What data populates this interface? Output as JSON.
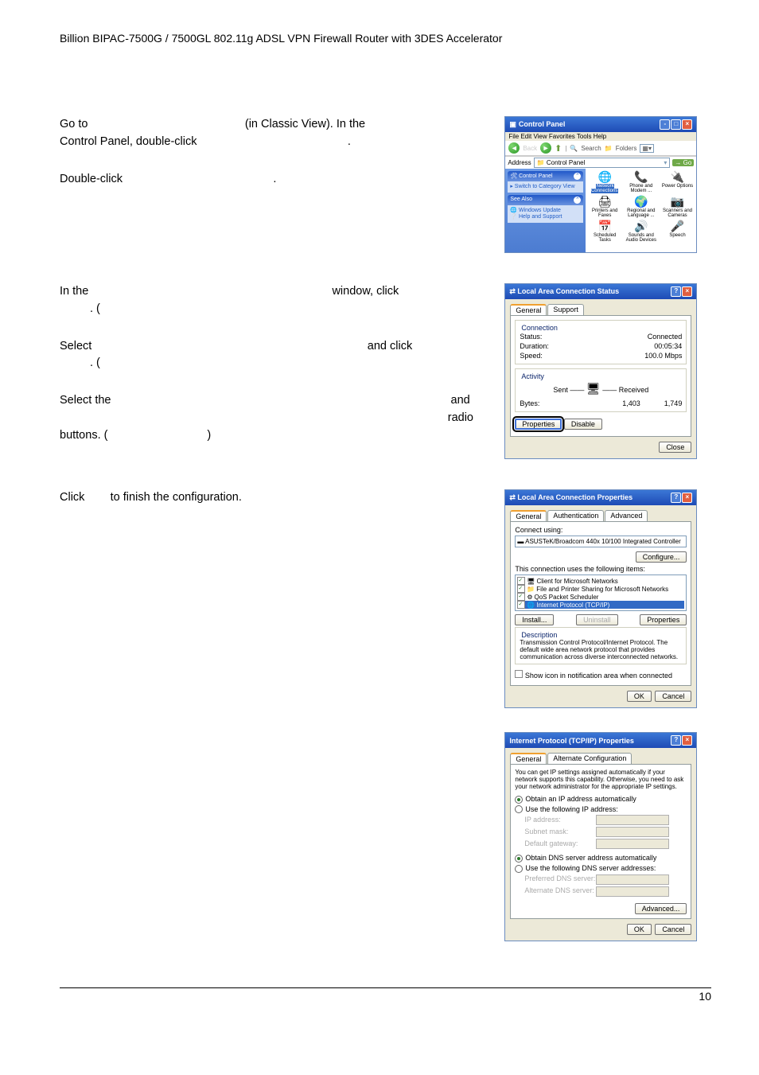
{
  "page": {
    "header": "Billion BIPAC-7500G / 7500GL 802.11g ADSL VPN Firewall Router with 3DES Accelerator",
    "footer_page": "10"
  },
  "instructions": {
    "step1a": "Go to",
    "step1b": "(in Classic View). In the",
    "step1c": "Control Panel, double-click",
    "step1d": ".",
    "step2a": "Double-click",
    "step2b": ".",
    "step3a": "In the",
    "step3b": "window, click",
    "step3c": ". (",
    "step4a": "Select",
    "step4b": "and   click",
    "step4c": ". (",
    "step5a": "Select the",
    "step5b": "and",
    "step5c": "radio",
    "step5d": "buttons. (",
    "step5e": ")",
    "step6a": "Click",
    "step6b": "to finish the configuration."
  },
  "win1": {
    "title": "Control Panel",
    "menubar": "File   Edit   View   Favorites   Tools   Help",
    "back": "Back",
    "search": "Search",
    "folders": "Folders",
    "addr_label": "Address",
    "addr_value": "Control Panel",
    "go": "Go",
    "side_title": "Control Panel",
    "side_switch": "Switch to Category View",
    "side_seealso": "See Also",
    "side_wu": "Windows Update",
    "side_help": "Help and Support",
    "icons": {
      "net": "Network Connections",
      "phone": "Phone and Modem ...",
      "power": "Power Options",
      "printers": "Printers and Faxes",
      "regional": "Regional and Language ...",
      "scanners": "Scanners and Cameras",
      "scheduled": "Scheduled Tasks",
      "sounds": "Sounds and Audio Devices",
      "speech": "Speech"
    }
  },
  "win2": {
    "title": "Local Area Connection Status",
    "tab_general": "General",
    "tab_support": "Support",
    "conn_legend": "Connection",
    "status_k": "Status:",
    "status_v": "Connected",
    "duration_k": "Duration:",
    "duration_v": "00:05:34",
    "speed_k": "Speed:",
    "speed_v": "100.0 Mbps",
    "act_legend": "Activity",
    "sent": "Sent",
    "received": "Received",
    "bytes_k": "Bytes:",
    "bytes_sent": "1,403",
    "bytes_recv": "1,749",
    "btn_props": "Properties",
    "btn_disable": "Disable",
    "btn_close": "Close"
  },
  "win3": {
    "title": "Local Area Connection Properties",
    "tab_general": "General",
    "tab_auth": "Authentication",
    "tab_adv": "Advanced",
    "connect_using": "Connect using:",
    "adapter": "ASUSTeK/Broadcom 440x 10/100 Integrated Controller",
    "btn_configure": "Configure...",
    "uses_following": "This connection uses the following items:",
    "item1": "Client for Microsoft Networks",
    "item2": "File and Printer Sharing for Microsoft Networks",
    "item3": "QoS Packet Scheduler",
    "item4": "Internet Protocol (TCP/IP)",
    "btn_install": "Install...",
    "btn_uninstall": "Uninstall",
    "btn_props": "Properties",
    "desc_legend": "Description",
    "desc_text": "Transmission Control Protocol/Internet Protocol. The default wide area network protocol that provides communication across diverse interconnected networks.",
    "show_icon": "Show icon in notification area when connected",
    "btn_ok": "OK",
    "btn_cancel": "Cancel"
  },
  "win4": {
    "title": "Internet Protocol (TCP/IP) Properties",
    "tab_general": "General",
    "tab_alt": "Alternate Configuration",
    "blurb": "You can get IP settings assigned automatically if your network supports this capability. Otherwise, you need to ask your network administrator for the appropriate IP settings.",
    "r1": "Obtain an IP address automatically",
    "r2": "Use the following IP address:",
    "ip": "IP address:",
    "subnet": "Subnet mask:",
    "gateway": "Default gateway:",
    "r3": "Obtain DNS server address automatically",
    "r4": "Use the following DNS server addresses:",
    "dns1": "Preferred DNS server:",
    "dns2": "Alternate DNS server:",
    "btn_adv": "Advanced...",
    "btn_ok": "OK",
    "btn_cancel": "Cancel"
  }
}
